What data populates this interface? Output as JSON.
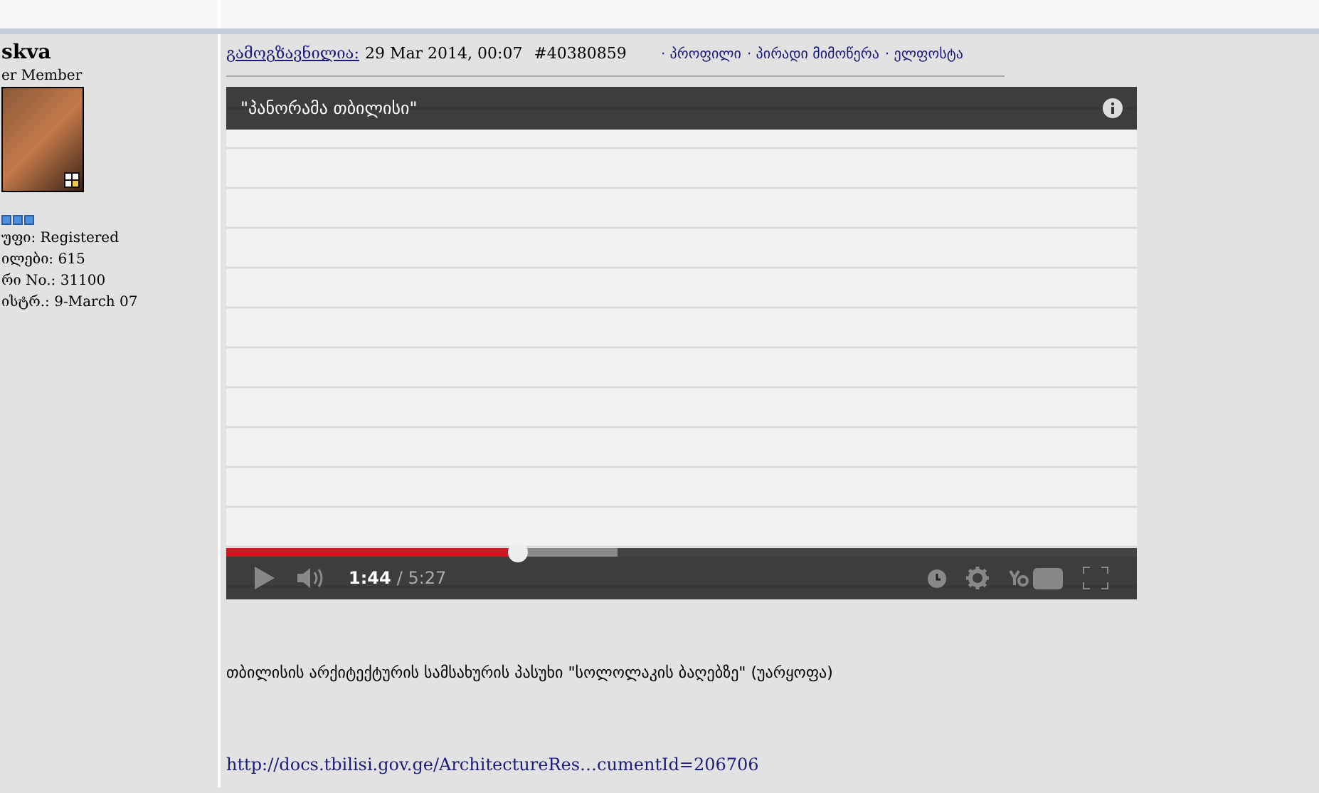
{
  "author": {
    "name": "skva",
    "rank": "er Member",
    "group": "უფი: Registered",
    "posts": "ილები: 615",
    "member_no": "რი No.: 31100",
    "registered": "ისტრ.: 9-March 07"
  },
  "post": {
    "sent_label": "გამოგზავნილია:",
    "date": "29 Mar 2014, 00:07",
    "number": "#40380859",
    "links": [
      "· პროფილი",
      "· პირადი მიმოწერა",
      "· ელფოსტა"
    ]
  },
  "video": {
    "title": "\"პანორამა თბილისი\"",
    "level": 0.32,
    "current_time": "1:44",
    "duration": "/ 5:27"
  },
  "body": {
    "text": "თბილისის არქიტექტურის სამსახურის პასუხი \"სოლოლაკის ბაღებზე\" (უარყოფა)",
    "link": "http://docs.tbilisi.gov.ge/ArchitectureRes…cumentId=206706"
  }
}
